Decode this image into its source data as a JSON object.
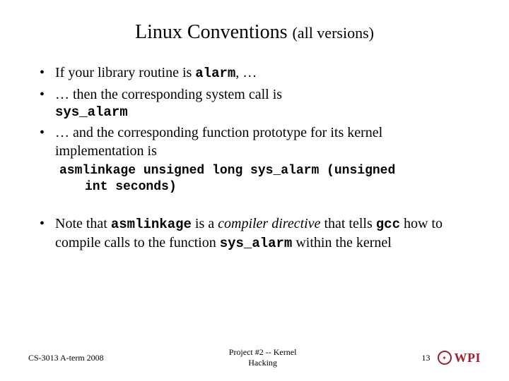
{
  "title": {
    "main": "Linux Conventions",
    "sub": "(all versions)"
  },
  "bullets": {
    "b1_pre": "If your library routine is ",
    "b1_code": "alarm",
    "b1_post": ", …",
    "b2_pre": "… then the corresponding system call is ",
    "b2_code": "sys_alarm",
    "b3_text": "… and the corresponding function prototype for its kernel implementation is",
    "b3_code_line1": "asmlinkage unsigned long sys_alarm (unsigned",
    "b3_code_line2": "int seconds)",
    "b4_pre": "Note that ",
    "b4_code1": "asmlinkage",
    "b4_mid1": " is a ",
    "b4_em": "compiler directive",
    "b4_mid2": " that tells ",
    "b4_code2": "gcc",
    "b4_mid3": " how to compile calls to the function ",
    "b4_code3": "sys_alarm",
    "b4_post": " within the kernel"
  },
  "footer": {
    "left": "CS-3013 A-term 2008",
    "center_l1": "Project #2 -- Kernel",
    "center_l2": "Hacking",
    "pagenum": "13",
    "logo_text": "WPI"
  }
}
